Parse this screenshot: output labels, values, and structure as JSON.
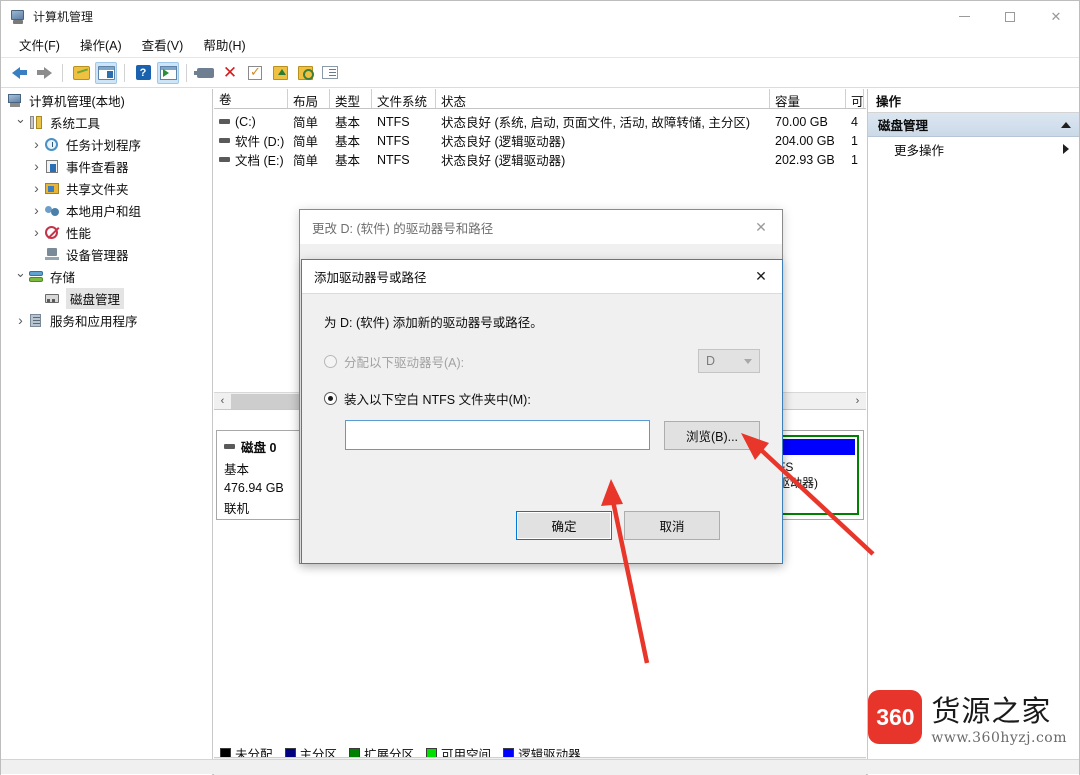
{
  "window": {
    "title": "计算机管理",
    "title_icon": "computer-management-icon",
    "controls": {
      "minimize": "minimize-icon",
      "maximize": "maximize-icon",
      "close": "close-icon"
    }
  },
  "menubar": {
    "items": [
      {
        "label": "文件(F)"
      },
      {
        "label": "操作(A)"
      },
      {
        "label": "查看(V)"
      },
      {
        "label": "帮助(H)"
      }
    ]
  },
  "toolbar": {
    "items": [
      {
        "name": "back-icon"
      },
      {
        "name": "forward-icon"
      },
      {
        "name": "up-folder-icon"
      },
      {
        "name": "show-console-tree-icon",
        "selected": true
      },
      {
        "name": "help-icon"
      },
      {
        "name": "show-action-pane-icon",
        "selected": true
      },
      {
        "name": "rescan-icon"
      },
      {
        "name": "delete-icon"
      },
      {
        "name": "properties-icon"
      },
      {
        "name": "export-list-icon"
      },
      {
        "name": "search-icon"
      },
      {
        "name": "detail-view-icon"
      }
    ]
  },
  "sidebar": {
    "items": [
      {
        "label": "计算机管理(本地)",
        "icon": "computer-icon",
        "indent": 0,
        "chevron": "none",
        "selected": false
      },
      {
        "label": "系统工具",
        "icon": "system-tools-icon",
        "indent": 1,
        "chevron": "down",
        "selected": false
      },
      {
        "label": "任务计划程序",
        "icon": "clock-icon",
        "indent": 2,
        "chevron": "right",
        "selected": false
      },
      {
        "label": "事件查看器",
        "icon": "event-viewer-icon",
        "indent": 2,
        "chevron": "right",
        "selected": false
      },
      {
        "label": "共享文件夹",
        "icon": "shared-folders-icon",
        "indent": 2,
        "chevron": "right",
        "selected": false
      },
      {
        "label": "本地用户和组",
        "icon": "local-users-groups-icon",
        "indent": 2,
        "chevron": "right",
        "selected": false
      },
      {
        "label": "性能",
        "icon": "performance-icon",
        "indent": 2,
        "chevron": "right",
        "selected": false
      },
      {
        "label": "设备管理器",
        "icon": "device-manager-icon",
        "indent": 2,
        "chevron": "none",
        "selected": false
      },
      {
        "label": "存储",
        "icon": "storage-icon",
        "indent": 1,
        "chevron": "down",
        "selected": false
      },
      {
        "label": "磁盘管理",
        "icon": "disk-management-icon",
        "indent": 2,
        "chevron": "none",
        "selected": true
      },
      {
        "label": "服务和应用程序",
        "icon": "services-apps-icon",
        "indent": 1,
        "chevron": "right",
        "selected": false
      }
    ]
  },
  "volume_table": {
    "headers": [
      "卷",
      "布局",
      "类型",
      "文件系统",
      "状态",
      "容量",
      "可"
    ],
    "rows": [
      {
        "volume": "(C:)",
        "layout": "简单",
        "type": "基本",
        "filesystem": "NTFS",
        "status": "状态良好 (系统, 启动, 页面文件, 活动, 故障转储, 主分区)",
        "capacity": "70.00 GB",
        "free": "4"
      },
      {
        "volume": "软件 (D:)",
        "layout": "简单",
        "type": "基本",
        "filesystem": "NTFS",
        "status": "状态良好 (逻辑驱动器)",
        "capacity": "204.00 GB",
        "free": "1"
      },
      {
        "volume": "文档 (E:)",
        "layout": "简单",
        "type": "基本",
        "filesystem": "NTFS",
        "status": "状态良好 (逻辑驱动器)",
        "capacity": "202.93 GB",
        "free": "1"
      }
    ],
    "scrollbar": {
      "left_arrow": "‹",
      "right_arrow": "›"
    }
  },
  "disk_panel": {
    "disk": {
      "name": "磁盘 0",
      "type": "基本",
      "size": "476.94 GB",
      "state": "联机"
    },
    "partition": {
      "line1": "FS",
      "line2": "驱动器)"
    },
    "legend": [
      {
        "label": "未分配",
        "color": "#000000"
      },
      {
        "label": "主分区",
        "color": "#000080"
      },
      {
        "label": "扩展分区",
        "color": "#008000"
      },
      {
        "label": "可用空间",
        "color": "#00e000"
      },
      {
        "label": "逻辑驱动器",
        "color": "#0000ff"
      }
    ]
  },
  "actions_panel": {
    "header": "操作",
    "group": "磁盘管理",
    "group_caret": "collapse-caret-icon",
    "item": "更多操作",
    "item_caret": "submenu-caret-icon"
  },
  "dialog_outer": {
    "title": "更改 D: (软件) 的驱动器号和路径",
    "close_icon": "close-icon",
    "ok_label": "确定",
    "cancel_label": "取消"
  },
  "dialog_inner": {
    "title": "添加驱动器号或路径",
    "close_icon": "close-icon",
    "description": "为 D: (软件) 添加新的驱动器号或路径。",
    "option_assign": {
      "label": "分配以下驱动器号(A):",
      "selected": false,
      "disabled": true,
      "dropdown_value": "D"
    },
    "option_mount": {
      "label": "装入以下空白 NTFS 文件夹中(M):",
      "selected": true,
      "disabled": false
    },
    "path_input": {
      "value": "",
      "placeholder": ""
    },
    "browse_label": "浏览(B)...",
    "ok_label": "确定",
    "cancel_label": "取消"
  },
  "annotations": {
    "arrow_color": "#e8362b",
    "arrows": [
      {
        "name": "arrow-to-ok-button",
        "target": "确定"
      },
      {
        "name": "arrow-to-browse-button",
        "target": "浏览(B)..."
      }
    ]
  },
  "watermark": {
    "logo_text": "360",
    "brand": "货源之家",
    "url": "www.360hyzj.com",
    "logo_color": "#e8352c"
  }
}
